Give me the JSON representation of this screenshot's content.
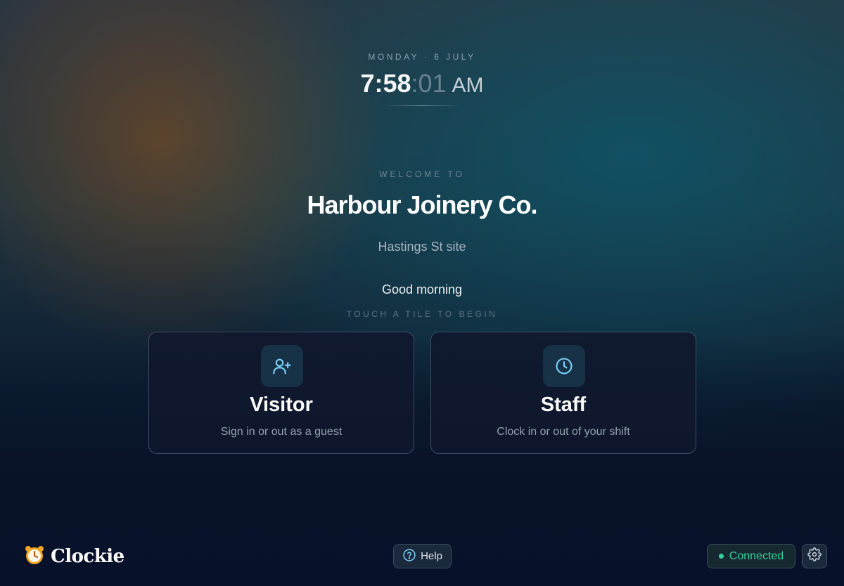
{
  "header": {
    "date": "MONDAY · 6 JULY",
    "time_hm": "7:58",
    "time_sec": ":01",
    "time_ampm": "AM"
  },
  "welcome": {
    "label": "WELCOME TO",
    "company": "Harbour Joinery Co.",
    "site": "Hastings St site",
    "greeting": "Good morning",
    "hint": "TOUCH A TILE TO BEGIN"
  },
  "tiles": [
    {
      "title": "Visitor",
      "subtitle": "Sign in or out as a guest",
      "icon": "user-plus-icon"
    },
    {
      "title": "Staff",
      "subtitle": "Clock in or out of your shift",
      "icon": "clock-icon"
    }
  ],
  "footer": {
    "brand": "Clockie",
    "brand_icon": "alarm-clock-icon",
    "help_label": "Help",
    "status_label": "Connected",
    "settings_icon": "gear-icon"
  },
  "colors": {
    "status_green": "#34d399",
    "icon_accent": "#7dd3fc",
    "tile_icon_bg": "#173146"
  }
}
